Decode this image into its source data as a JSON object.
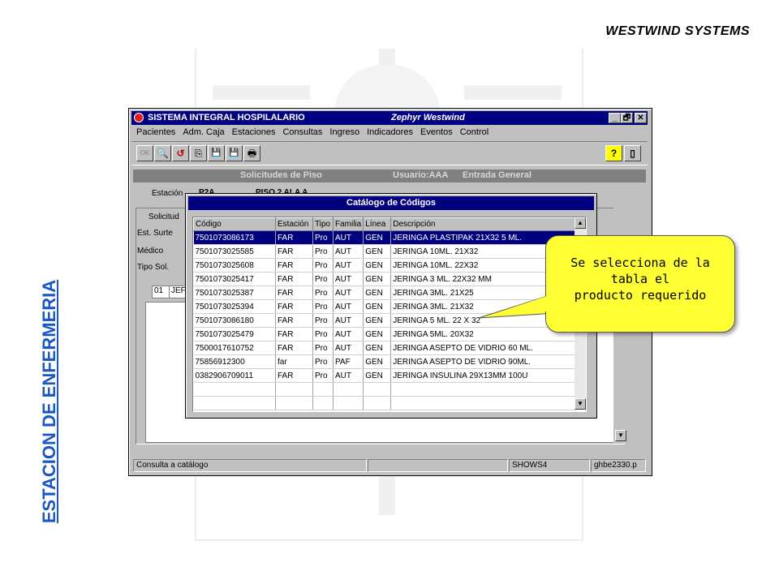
{
  "brand": "WESTWIND SYSTEMS",
  "side_title": "ESTACION DE ENFERMERIA",
  "window": {
    "title": "SISTEMA INTEGRAL HOSPILALARIO",
    "subtitle": "Zephyr Westwind",
    "controls": [
      "_",
      "🗗",
      "✕"
    ],
    "menu": [
      "Pacientes",
      "Adm. Caja",
      "Estaciones",
      "Consultas",
      "Ingreso",
      "Indicadores",
      "Eventos",
      "Control"
    ],
    "toolbar_left": [
      "OK",
      "🔍",
      "↺",
      "⎘",
      "💾",
      "💾",
      "🖶"
    ],
    "toolbar_right": [
      "?",
      "▯"
    ]
  },
  "form": {
    "header_title": "Solicitudes de Piso",
    "header_user": "Usuario:AAA",
    "header_mode": "Entrada General",
    "estacion_label": "Estación",
    "estacion_value": "P2A",
    "piso_value": "PISO 2 ALA A",
    "labels": [
      "Solicitud",
      "Est. Surte",
      "Médico",
      "Tipo Sol."
    ],
    "line_code": "01",
    "line_text": "JEF"
  },
  "dialog": {
    "title": "Catálogo de Códigos",
    "columns": [
      "Código",
      "Estación",
      "Tipo",
      "Familia",
      "Línea",
      "Descripción"
    ],
    "rows": [
      [
        "7501073086173",
        "FAR",
        "Pro",
        "AUT",
        "GEN",
        "JERINGA  PLASTIPAK 21X32 5 ML."
      ],
      [
        "7501073025585",
        "FAR",
        "Pro",
        "AUT",
        "GEN",
        "JERINGA 10ML. 21X32"
      ],
      [
        "7501073025608",
        "FAR",
        "Pro",
        "AUT",
        "GEN",
        "JERINGA 10ML. 22X32"
      ],
      [
        "7501073025417",
        "FAR",
        "Pro",
        "AUT",
        "GEN",
        "JERINGA 3 ML. 22X32 MM"
      ],
      [
        "7501073025387",
        "FAR",
        "Pro",
        "AUT",
        "GEN",
        "JERINGA 3ML. 21X25"
      ],
      [
        "7501073025394",
        "FAR",
        "Pro",
        "AUT",
        "GEN",
        "JERINGA 3ML. 21X32"
      ],
      [
        "7501073086180",
        "FAR",
        "Pro",
        "AUT",
        "GEN",
        "JERINGA 5 ML. 22 X 32"
      ],
      [
        "7501073025479",
        "FAR",
        "Pro",
        "AUT",
        "GEN",
        "JERINGA 5ML. 20X32"
      ],
      [
        "7500017610752",
        "FAR",
        "Pro",
        "AUT",
        "GEN",
        "JERINGA ASEPTO DE VIDRIO 60 ML."
      ],
      [
        "75856912300",
        "far",
        "Pro",
        "PAF",
        "GEN",
        "JERINGA ASEPTO DE VIDRIO 90ML."
      ],
      [
        "0382906709011",
        "FAR",
        "Pro",
        "AUT",
        "GEN",
        "JERINGA INSULINA 29X13MM 100U"
      ]
    ],
    "selected_row": 0
  },
  "status": [
    "Consulta a catálogo",
    "",
    "SHOWS4",
    "ghbe2330.p"
  ],
  "callout": {
    "line1": "Se selecciona de la",
    "line2": "tabla el",
    "line3": "producto requerido"
  }
}
